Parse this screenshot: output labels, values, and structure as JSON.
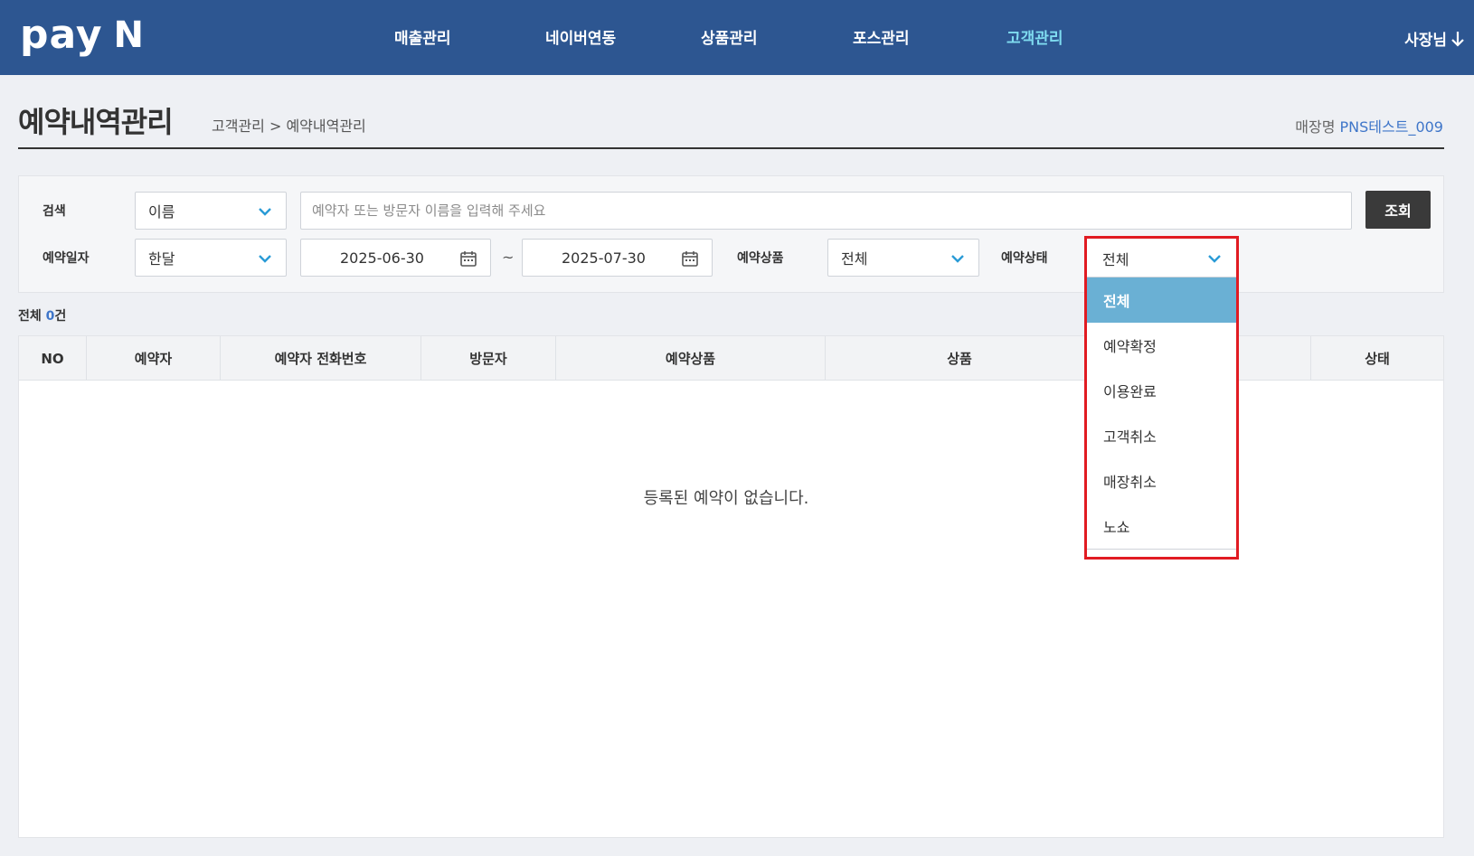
{
  "brand": {
    "logo_text": "pay",
    "logo_mark": "N"
  },
  "nav": {
    "items": [
      {
        "label": "매출관리",
        "active": false
      },
      {
        "label": "네이버연동",
        "active": false
      },
      {
        "label": "상품관리",
        "active": false
      },
      {
        "label": "포스관리",
        "active": false
      },
      {
        "label": "고객관리",
        "active": true
      }
    ],
    "user_label": "사장님"
  },
  "page": {
    "title": "예약내역관리",
    "breadcrumb": "고객관리 > 예약내역관리",
    "store_label": "매장명",
    "store_value": "PNS테스트_009"
  },
  "search": {
    "search_label": "검색",
    "search_type": "이름",
    "search_placeholder": "예약자 또는 방문자 이름을 입력해 주세요",
    "search_button": "조회",
    "date_label": "예약일자",
    "date_period": "한달",
    "date_from": "2025-06-30",
    "date_sep": "~",
    "date_to": "2025-07-30",
    "product_label": "예약상품",
    "product_value": "전체",
    "status_label": "예약상태",
    "status_value": "전체"
  },
  "status_options": [
    "전체",
    "예약확정",
    "이용완료",
    "고객취소",
    "매장취소",
    "노쇼"
  ],
  "list": {
    "total_label": "전체",
    "total_count": "0",
    "total_unit": "건",
    "columns": [
      "NO",
      "예약자",
      "예약자 전화번호",
      "방문자",
      "예약상품",
      "상품",
      "",
      "상태"
    ],
    "empty_message": "등록된 예약이 없습니다."
  },
  "colors": {
    "header_bg": "#2d5691",
    "active_nav": "#7fdcf0",
    "selected_option": "#6ab0d4",
    "highlight": "#e11b22",
    "link": "#3f76c9"
  }
}
